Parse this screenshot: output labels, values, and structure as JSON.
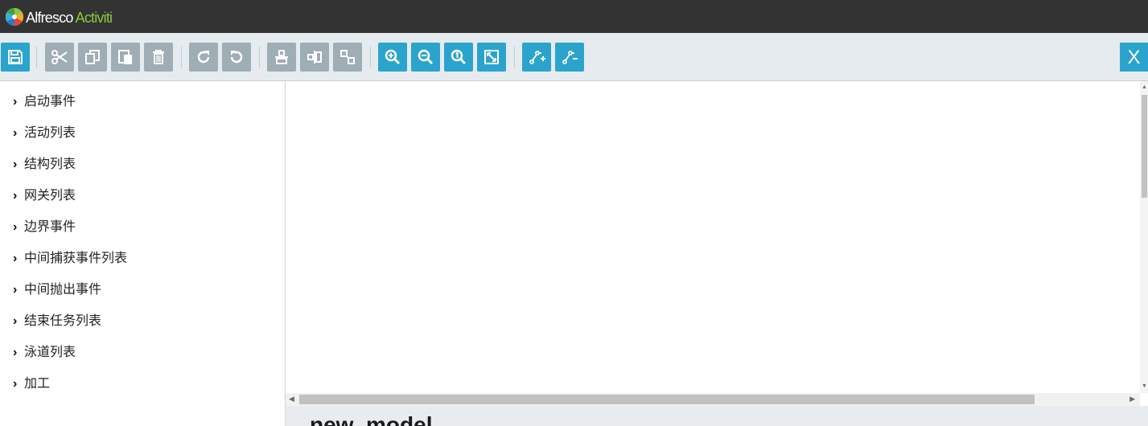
{
  "app": {
    "brand_part1": "Alfresco",
    "brand_part2": "Activiti"
  },
  "colors": {
    "topbar": "#333333",
    "toolbar": "#e6ebef",
    "button_gray": "#9fadb5",
    "button_blue": "#2ba4cd",
    "brand_green": "#8cc63f"
  },
  "toolbar": {
    "close_label": "X",
    "buttons": [
      {
        "icon": "save-icon"
      },
      {
        "icon": "cut-icon"
      },
      {
        "icon": "copy-icon"
      },
      {
        "icon": "paste-icon"
      },
      {
        "icon": "delete-icon"
      },
      {
        "icon": "redo-icon"
      },
      {
        "icon": "undo-icon"
      },
      {
        "icon": "align-horizontal-icon"
      },
      {
        "icon": "align-vertical-icon"
      },
      {
        "icon": "same-size-icon"
      },
      {
        "icon": "zoom-in-icon"
      },
      {
        "icon": "zoom-out-icon"
      },
      {
        "icon": "zoom-actual-icon"
      },
      {
        "icon": "zoom-fit-icon"
      },
      {
        "icon": "add-bendpoint-icon"
      },
      {
        "icon": "remove-bendpoint-icon"
      }
    ]
  },
  "sidebar": {
    "groups": [
      {
        "label": "启动事件"
      },
      {
        "label": "活动列表"
      },
      {
        "label": "结构列表"
      },
      {
        "label": "网关列表"
      },
      {
        "label": "边界事件"
      },
      {
        "label": "中间捕获事件列表"
      },
      {
        "label": "中间抛出事件"
      },
      {
        "label": "结束任务列表"
      },
      {
        "label": "泳道列表"
      },
      {
        "label": "加工"
      }
    ]
  },
  "properties": {
    "model_name": "new_model"
  }
}
